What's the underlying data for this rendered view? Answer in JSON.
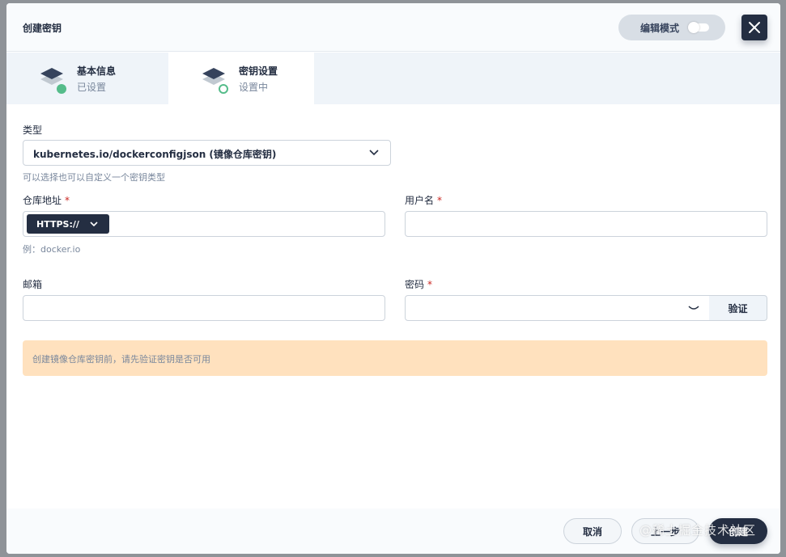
{
  "modal": {
    "title": "创建密钥",
    "edit_mode_label": "编辑模式"
  },
  "steps": [
    {
      "title": "基本信息",
      "status": "已设置"
    },
    {
      "title": "密钥设置",
      "status": "设置中"
    }
  ],
  "form": {
    "type": {
      "label": "类型",
      "value": "kubernetes.io/dockerconfigjson (镜像仓库密钥)",
      "hint": "可以选择也可以自定义一个密钥类型"
    },
    "registry": {
      "label": "仓库地址",
      "required_mark": "*",
      "protocol": "HTTPS://",
      "value": "",
      "hint": "例：docker.io"
    },
    "username": {
      "label": "用户名",
      "required_mark": "*",
      "value": ""
    },
    "email": {
      "label": "邮箱",
      "value": ""
    },
    "password": {
      "label": "密码",
      "required_mark": "*",
      "value": "",
      "verify_label": "验证"
    }
  },
  "alert": {
    "text": "创建镜像仓库密钥前，请先验证密钥是否可用"
  },
  "footer": {
    "cancel_label": "取消",
    "prev_label": "上一步",
    "create_label": "创建"
  },
  "watermark": "@稀土掘金技术社区",
  "colors": {
    "primary_dark": "#242e42",
    "success_green": "#55bc8a",
    "alert_bg": "#ffe1be",
    "required_red": "#ca2621"
  }
}
